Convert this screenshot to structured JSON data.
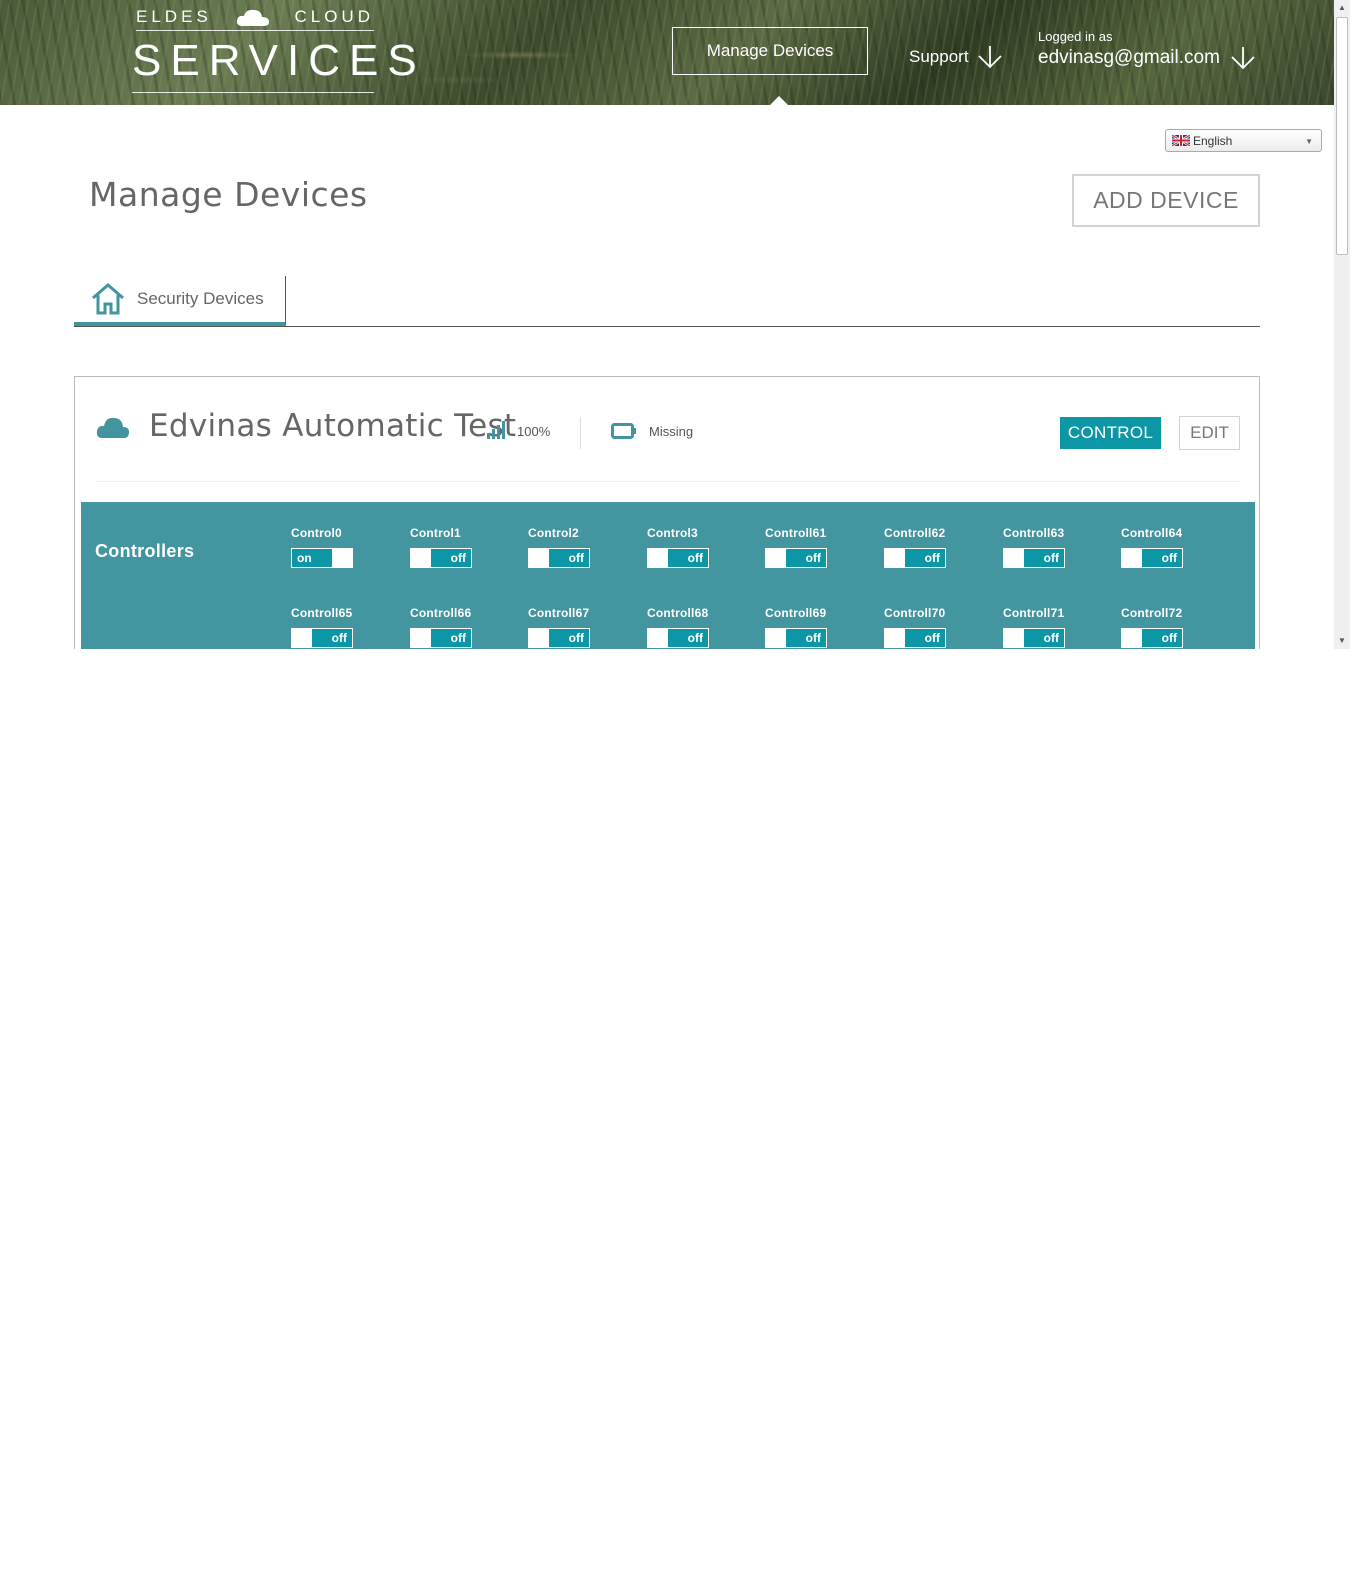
{
  "brand": {
    "logo_top_left": "ELDES",
    "logo_top_right": "CLOUD",
    "logo_main": "SERVICES"
  },
  "nav": {
    "manage_devices": "Manage Devices",
    "support": "Support",
    "logged_in_label": "Logged in as",
    "user_email": "edvinasg@gmail.com"
  },
  "language": {
    "selected": "English"
  },
  "page": {
    "title": "Manage Devices",
    "add_device": "ADD DEVICE"
  },
  "tabs": [
    {
      "label": "Security Devices",
      "icon": "home-icon"
    }
  ],
  "device": {
    "name": "Edvinas Automatic Test",
    "signal": "100%",
    "battery_status": "Missing",
    "control_label": "CONTROL",
    "edit_label": "EDIT"
  },
  "controllers": {
    "title": "Controllers",
    "items": [
      {
        "label": "Control0",
        "state": "on"
      },
      {
        "label": "Control1",
        "state": "off"
      },
      {
        "label": "Control2",
        "state": "off"
      },
      {
        "label": "Control3",
        "state": "off"
      },
      {
        "label": "Controll61",
        "state": "off"
      },
      {
        "label": "Controll62",
        "state": "off"
      },
      {
        "label": "Controll63",
        "state": "off"
      },
      {
        "label": "Controll64",
        "state": "off"
      },
      {
        "label": "Controll65",
        "state": "off"
      },
      {
        "label": "Controll66",
        "state": "off"
      },
      {
        "label": "Controll67",
        "state": "off"
      },
      {
        "label": "Controll68",
        "state": "off"
      },
      {
        "label": "Controll69",
        "state": "off"
      },
      {
        "label": "Controll70",
        "state": "off"
      },
      {
        "label": "Controll71",
        "state": "off"
      },
      {
        "label": "Controll72",
        "state": "off"
      }
    ]
  },
  "colors": {
    "accent": "#0d97a6",
    "panel": "#43959f",
    "text_muted": "#666666"
  }
}
